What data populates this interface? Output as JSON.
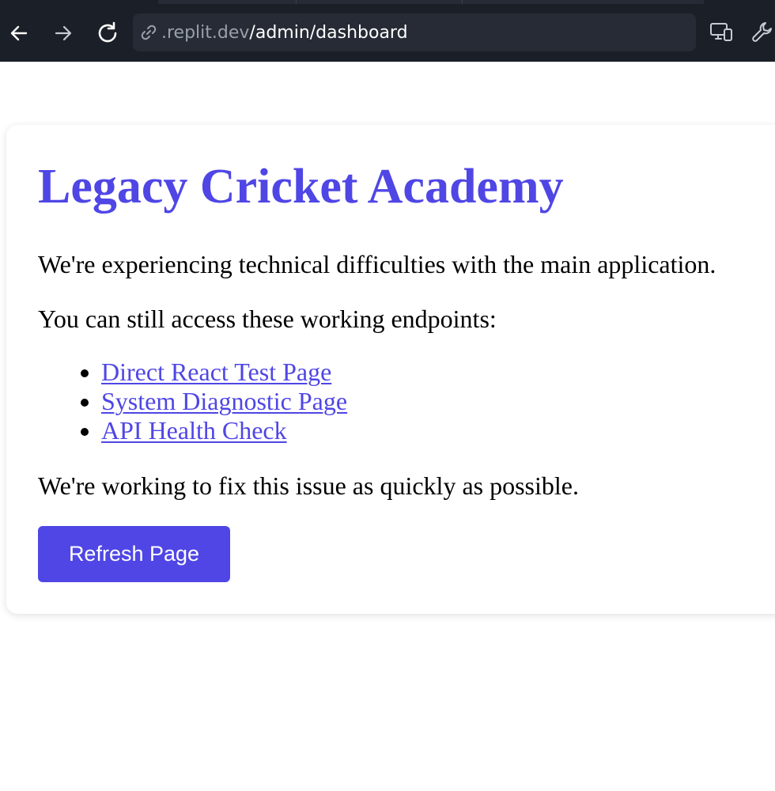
{
  "browser": {
    "url_host": ".replit.dev",
    "url_path": "/admin/dashboard",
    "icons": {
      "back": "arrow-left-icon",
      "forward": "arrow-right-icon",
      "reload": "reload-icon",
      "url": "link-icon",
      "devices": "responsive-devices-icon",
      "tools": "wrench-icon"
    },
    "colors": {
      "chrome_bg": "#1b1f27",
      "urlbar_bg": "#262b35",
      "url_host": "#9aa0ab"
    }
  },
  "page": {
    "title": "Legacy Cricket Academy",
    "intro": "We're experiencing technical difficulties with the main application.",
    "endpoints_intro": "You can still access these working endpoints:",
    "links": [
      {
        "label": "Direct React Test Page"
      },
      {
        "label": "System Diagnostic Page"
      },
      {
        "label": "API Health Check"
      }
    ],
    "closing": "We're working to fix this issue as quickly as possible.",
    "refresh_label": "Refresh Page",
    "colors": {
      "accent": "#4f46e5",
      "text": "#000000",
      "card_bg": "#ffffff"
    }
  }
}
